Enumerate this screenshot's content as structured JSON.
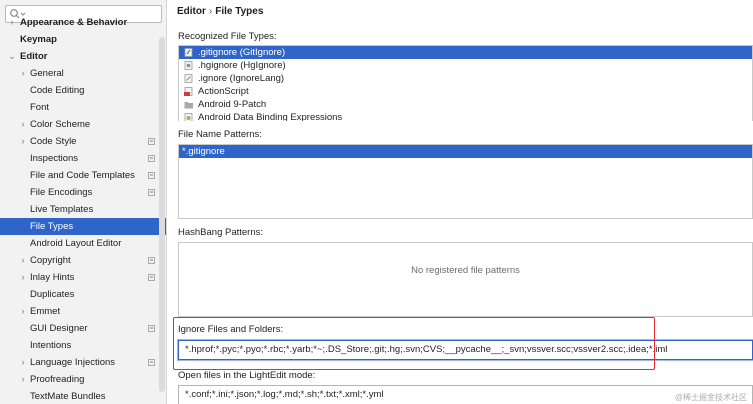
{
  "settings_search": {
    "placeholder": "",
    "value": ""
  },
  "tree": {
    "cut_top_item": {
      "label": "Appearance & Behavior",
      "indent": 1,
      "arrow": true,
      "bold": true
    },
    "items": [
      {
        "label": "Keymap",
        "indent": 1,
        "arrow": false,
        "bold": true,
        "project_icon": false
      },
      {
        "label": "Editor",
        "indent": 1,
        "arrow": "down",
        "bold": true,
        "project_icon": false
      },
      {
        "label": "General",
        "indent": 2,
        "arrow": "right",
        "bold": false,
        "project_icon": false
      },
      {
        "label": "Code Editing",
        "indent": 2,
        "arrow": false,
        "bold": false,
        "project_icon": false
      },
      {
        "label": "Font",
        "indent": 2,
        "arrow": false,
        "bold": false,
        "project_icon": false
      },
      {
        "label": "Color Scheme",
        "indent": 2,
        "arrow": "right",
        "bold": false,
        "project_icon": false
      },
      {
        "label": "Code Style",
        "indent": 2,
        "arrow": "right",
        "bold": false,
        "project_icon": true
      },
      {
        "label": "Inspections",
        "indent": 2,
        "arrow": false,
        "bold": false,
        "project_icon": true
      },
      {
        "label": "File and Code Templates",
        "indent": 2,
        "arrow": false,
        "bold": false,
        "project_icon": true
      },
      {
        "label": "File Encodings",
        "indent": 2,
        "arrow": false,
        "bold": false,
        "project_icon": true
      },
      {
        "label": "Live Templates",
        "indent": 2,
        "arrow": false,
        "bold": false,
        "project_icon": false
      },
      {
        "label": "File Types",
        "indent": 2,
        "arrow": false,
        "bold": false,
        "project_icon": false,
        "selected": true
      },
      {
        "label": "Android Layout Editor",
        "indent": 2,
        "arrow": false,
        "bold": false,
        "project_icon": false
      },
      {
        "label": "Copyright",
        "indent": 2,
        "arrow": "right",
        "bold": false,
        "project_icon": true
      },
      {
        "label": "Inlay Hints",
        "indent": 2,
        "arrow": "right",
        "bold": false,
        "project_icon": true
      },
      {
        "label": "Duplicates",
        "indent": 2,
        "arrow": false,
        "bold": false,
        "project_icon": false
      },
      {
        "label": "Emmet",
        "indent": 2,
        "arrow": "right",
        "bold": false,
        "project_icon": false
      },
      {
        "label": "GUI Designer",
        "indent": 2,
        "arrow": false,
        "bold": false,
        "project_icon": true
      },
      {
        "label": "Intentions",
        "indent": 2,
        "arrow": false,
        "bold": false,
        "project_icon": false
      },
      {
        "label": "Language Injections",
        "indent": 2,
        "arrow": "right",
        "bold": false,
        "project_icon": true
      },
      {
        "label": "Proofreading",
        "indent": 2,
        "arrow": "right",
        "bold": false,
        "project_icon": false
      },
      {
        "label": "TextMate Bundles",
        "indent": 2,
        "arrow": false,
        "bold": false,
        "project_icon": false
      }
    ]
  },
  "breadcrumb": {
    "parent": "Editor",
    "separator": "›",
    "current": "File Types"
  },
  "recognized": {
    "label": "Recognized File Types:",
    "items": [
      {
        "text": ".gitignore (GitIgnore)",
        "icon": "gitignore-file-icon",
        "selected": true
      },
      {
        "text": ".hgignore (HgIgnore)",
        "icon": "hgignore-file-icon",
        "selected": false
      },
      {
        "text": ".ignore (IgnoreLang)",
        "icon": "ignore-file-icon",
        "selected": false
      },
      {
        "text": "ActionScript",
        "icon": "actionscript-file-icon",
        "selected": false
      },
      {
        "text": "Android 9-Patch",
        "icon": "folder-icon",
        "selected": false
      },
      {
        "text": "Android Data Binding Expressions",
        "icon": "android-file-icon",
        "selected": false
      }
    ]
  },
  "file_name_patterns": {
    "label": "File Name Patterns:",
    "items": [
      {
        "text": "*.gitignore",
        "selected": true
      }
    ]
  },
  "hashbang": {
    "label": "HashBang Patterns:",
    "empty_text": "No registered file patterns"
  },
  "ignore": {
    "label": "Ignore Files and Folders:",
    "value": "*.hprof;*.pyc;*.pyo;*.rbc;*.yarb;*~;.DS_Store;.git;.hg;.svn;CVS;__pycache__;_svn;vssver.scc;vssver2.scc;.idea;*.iml"
  },
  "lightedit": {
    "label": "Open files in the LightEdit mode:",
    "value": "*.conf;*.ini;*.json;*.log;*.md;*.sh;*.txt;*.xml;*.yml"
  },
  "watermark": "@稀土掘金技术社区",
  "colors": {
    "selection": "#2f65ca",
    "highlight_box": "#e52d2d"
  }
}
